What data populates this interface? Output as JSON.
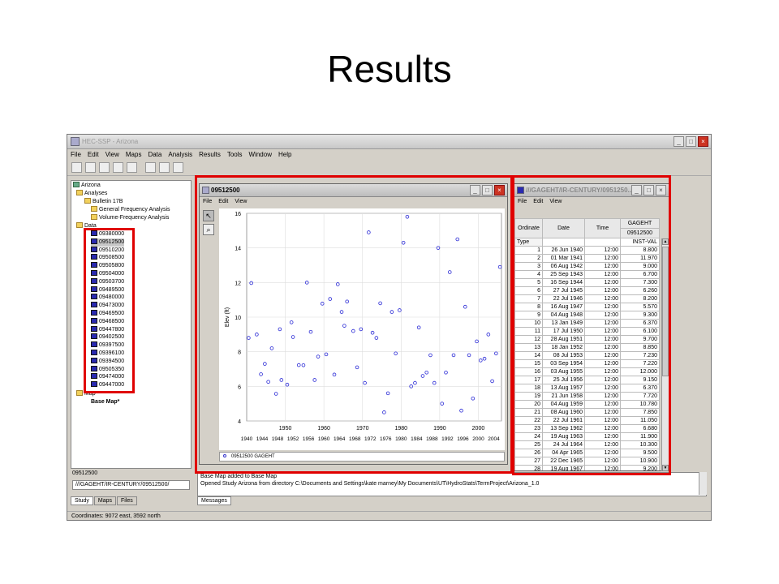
{
  "slide": {
    "title": "Results"
  },
  "app": {
    "title": "HEC-SSP - Arizona",
    "menu": [
      "File",
      "Edit",
      "View",
      "Maps",
      "Data",
      "Analysis",
      "Results",
      "Tools",
      "Window",
      "Help"
    ]
  },
  "tree": {
    "root": "Arizona",
    "analyses": "Analyses",
    "bulletin": "Bulletin 17B",
    "gfa": "General Frequency Analysis",
    "vfa": "Volume-Frequency Analysis",
    "data": "Data",
    "stations": [
      "09380000",
      "09512500",
      "09510200",
      "09508500",
      "09505800",
      "09504000",
      "09503700",
      "09489500",
      "09480000",
      "09473000",
      "09469500",
      "09468500",
      "09447800",
      "09402500",
      "09397500",
      "09396100",
      "09394500",
      "09505350",
      "09474000",
      "09447000"
    ],
    "map": "Map",
    "basemap": "Base Map*"
  },
  "leftpanel": {
    "label": "09512500",
    "path": "///GAGEHT/IR-CENTURY/09512500/",
    "tabs": [
      "Study",
      "Maps",
      "Files"
    ]
  },
  "messages": {
    "lines": [
      "Base Map added to Base Map",
      "Opened Study Arizona from directory C:\\Documents and Settings\\kate marney\\My Documents\\UT\\HydroStats\\TermProject\\Arizona_1.0"
    ],
    "tab": "Messages"
  },
  "status": {
    "coords": "Coordinates: 9072 east, 3592 north"
  },
  "plotwin": {
    "title": "09512500",
    "menu": [
      "File",
      "Edit",
      "View"
    ],
    "legend": "09512500 GAGEHT"
  },
  "tablewin": {
    "title": "///GAGEHT/IR-CENTURY/0951250...",
    "menu": [
      "File",
      "Edit",
      "View"
    ],
    "headers": {
      "ordinate": "Ordinate",
      "date": "Date",
      "time": "Time",
      "param": "GAGEHT",
      "station": "09512500",
      "type": "Type",
      "typeval": "INST-VAL"
    },
    "rows": [
      [
        "1",
        "26 Jun 1940",
        "12:00",
        "8.800"
      ],
      [
        "2",
        "01 Mar 1941",
        "12:00",
        "11.970"
      ],
      [
        "3",
        "06 Aug 1942",
        "12:00",
        "9.000"
      ],
      [
        "4",
        "25 Sep 1943",
        "12:00",
        "6.700"
      ],
      [
        "5",
        "16 Sep 1944",
        "12:00",
        "7.300"
      ],
      [
        "6",
        "27 Jul 1945",
        "12:00",
        "6.260"
      ],
      [
        "7",
        "22 Jul 1946",
        "12:00",
        "8.200"
      ],
      [
        "8",
        "16 Aug 1947",
        "12:00",
        "5.570"
      ],
      [
        "9",
        "04 Aug 1948",
        "12:00",
        "9.300"
      ],
      [
        "10",
        "13 Jan 1949",
        "12:00",
        "6.370"
      ],
      [
        "11",
        "17 Jul 1950",
        "12:00",
        "6.100"
      ],
      [
        "12",
        "28 Aug 1951",
        "12:00",
        "9.700"
      ],
      [
        "13",
        "18 Jan 1952",
        "12:00",
        "8.850"
      ],
      [
        "14",
        "08 Jul 1953",
        "12:00",
        "7.230"
      ],
      [
        "15",
        "03 Sep 1954",
        "12:00",
        "7.220"
      ],
      [
        "16",
        "03 Aug 1955",
        "12:00",
        "12.000"
      ],
      [
        "17",
        "25 Jul 1956",
        "12:00",
        "9.150"
      ],
      [
        "18",
        "13 Aug 1957",
        "12:00",
        "6.370"
      ],
      [
        "19",
        "21 Jun 1958",
        "12:00",
        "7.720"
      ],
      [
        "20",
        "04 Aug 1959",
        "12:00",
        "10.780"
      ],
      [
        "21",
        "08 Aug 1960",
        "12:00",
        "7.850"
      ],
      [
        "22",
        "22 Jul 1961",
        "12:00",
        "11.050"
      ],
      [
        "23",
        "13 Sep 1962",
        "12:00",
        "6.680"
      ],
      [
        "24",
        "19 Aug 1963",
        "12:00",
        "11.900"
      ],
      [
        "25",
        "24 Jul 1964",
        "12:00",
        "10.300"
      ],
      [
        "26",
        "04 Apr 1965",
        "12:00",
        "9.500"
      ],
      [
        "27",
        "22 Dec 1965",
        "12:00",
        "10.900"
      ],
      [
        "28",
        "19 Aug 1967",
        "12:00",
        "9.200"
      ]
    ]
  },
  "chart_data": {
    "type": "scatter",
    "ylabel": "Elev (ft)",
    "xlim": [
      1940,
      2006
    ],
    "ylim": [
      4,
      16
    ],
    "yticks": [
      "4",
      "6",
      "8",
      "10",
      "12",
      "14",
      "16"
    ],
    "xticks_major": [
      "1950",
      "1960",
      "1970",
      "1980",
      "1990",
      "2000"
    ],
    "xticks_minor": [
      "1940",
      "1944",
      "1948",
      "1952",
      "1956",
      "1960",
      "1964",
      "1968",
      "1972",
      "1976",
      "1980",
      "1984",
      "1988",
      "1992",
      "1996",
      "2000",
      "2004"
    ],
    "series": [
      {
        "x": [
          1940.5,
          1941.2,
          1942.6,
          1943.7,
          1944.7,
          1945.6,
          1946.5,
          1947.6,
          1948.6,
          1949.0,
          1950.5,
          1951.6,
          1952.0,
          1953.5,
          1954.7,
          1955.6,
          1956.6,
          1957.6,
          1958.5,
          1959.6,
          1960.6,
          1961.6,
          1962.7,
          1963.6,
          1964.6,
          1965.3,
          1966.0,
          1967.6,
          1968.6,
          1969.6,
          1970.6,
          1971.6,
          1972.6,
          1973.6,
          1974.6,
          1975.6,
          1976.6,
          1977.6,
          1978.6,
          1979.6,
          1980.6,
          1981.6,
          1982.6,
          1983.6,
          1984.6,
          1985.6,
          1986.6,
          1987.6,
          1988.6,
          1989.6,
          1990.6,
          1991.6,
          1992.6,
          1993.6,
          1994.6,
          1995.6,
          1996.6,
          1997.6,
          1998.6,
          1999.6,
          2000.6,
          2001.6,
          2002.6,
          2003.6,
          2004.6,
          2005.6
        ],
        "y": [
          8.8,
          11.97,
          9.0,
          6.7,
          7.3,
          6.26,
          8.2,
          5.57,
          9.3,
          6.37,
          6.1,
          9.7,
          8.85,
          7.23,
          7.22,
          12.0,
          9.15,
          6.37,
          7.72,
          10.78,
          7.85,
          11.05,
          6.68,
          11.9,
          10.3,
          9.5,
          10.9,
          9.2,
          7.1,
          9.3,
          6.2,
          14.9,
          9.1,
          8.8,
          10.8,
          4.5,
          5.6,
          10.3,
          7.9,
          10.4,
          14.3,
          15.8,
          6.0,
          6.2,
          9.4,
          6.6,
          6.8,
          7.8,
          6.2,
          14.0,
          5.0,
          6.8,
          12.6,
          7.8,
          14.5,
          4.6,
          10.6,
          7.8,
          5.3,
          8.6,
          7.5,
          7.6,
          9.0,
          6.3,
          7.9,
          12.9
        ]
      }
    ]
  }
}
